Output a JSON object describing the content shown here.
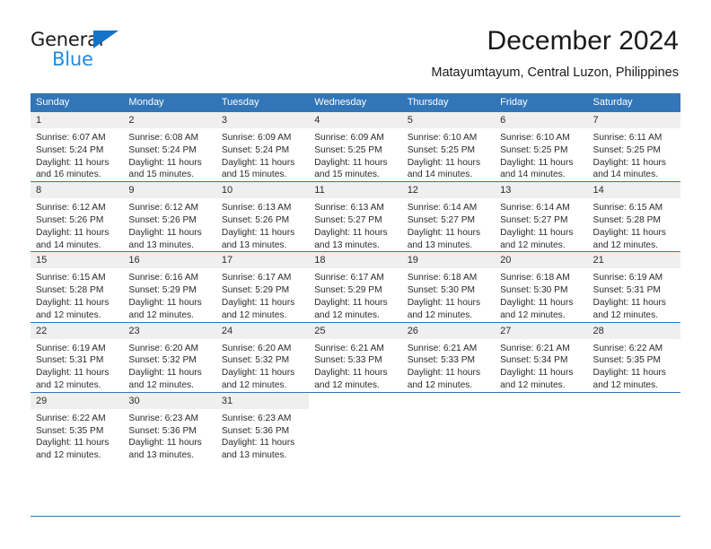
{
  "brand": {
    "name_top": "General",
    "name_bottom": "Blue",
    "triangle_icon": "blue-triangle-logo-mark",
    "accent_color": "#1f8ae0"
  },
  "header": {
    "title": "December 2024",
    "subtitle": "Matayumtayum, Central Luzon, Philippines"
  },
  "theme": {
    "header_blue": "#3276b8",
    "daynum_band": "#efefef",
    "text": "#2b2b2b"
  },
  "weekdays": [
    "Sunday",
    "Monday",
    "Tuesday",
    "Wednesday",
    "Thursday",
    "Friday",
    "Saturday"
  ],
  "weeks": [
    [
      {
        "day": "1",
        "sunrise": "Sunrise: 6:07 AM",
        "sunset": "Sunset: 5:24 PM",
        "daylight1": "Daylight: 11 hours",
        "daylight2": "and 16 minutes."
      },
      {
        "day": "2",
        "sunrise": "Sunrise: 6:08 AM",
        "sunset": "Sunset: 5:24 PM",
        "daylight1": "Daylight: 11 hours",
        "daylight2": "and 15 minutes."
      },
      {
        "day": "3",
        "sunrise": "Sunrise: 6:09 AM",
        "sunset": "Sunset: 5:24 PM",
        "daylight1": "Daylight: 11 hours",
        "daylight2": "and 15 minutes."
      },
      {
        "day": "4",
        "sunrise": "Sunrise: 6:09 AM",
        "sunset": "Sunset: 5:25 PM",
        "daylight1": "Daylight: 11 hours",
        "daylight2": "and 15 minutes."
      },
      {
        "day": "5",
        "sunrise": "Sunrise: 6:10 AM",
        "sunset": "Sunset: 5:25 PM",
        "daylight1": "Daylight: 11 hours",
        "daylight2": "and 14 minutes."
      },
      {
        "day": "6",
        "sunrise": "Sunrise: 6:10 AM",
        "sunset": "Sunset: 5:25 PM",
        "daylight1": "Daylight: 11 hours",
        "daylight2": "and 14 minutes."
      },
      {
        "day": "7",
        "sunrise": "Sunrise: 6:11 AM",
        "sunset": "Sunset: 5:25 PM",
        "daylight1": "Daylight: 11 hours",
        "daylight2": "and 14 minutes."
      }
    ],
    [
      {
        "day": "8",
        "sunrise": "Sunrise: 6:12 AM",
        "sunset": "Sunset: 5:26 PM",
        "daylight1": "Daylight: 11 hours",
        "daylight2": "and 14 minutes."
      },
      {
        "day": "9",
        "sunrise": "Sunrise: 6:12 AM",
        "sunset": "Sunset: 5:26 PM",
        "daylight1": "Daylight: 11 hours",
        "daylight2": "and 13 minutes."
      },
      {
        "day": "10",
        "sunrise": "Sunrise: 6:13 AM",
        "sunset": "Sunset: 5:26 PM",
        "daylight1": "Daylight: 11 hours",
        "daylight2": "and 13 minutes."
      },
      {
        "day": "11",
        "sunrise": "Sunrise: 6:13 AM",
        "sunset": "Sunset: 5:27 PM",
        "daylight1": "Daylight: 11 hours",
        "daylight2": "and 13 minutes."
      },
      {
        "day": "12",
        "sunrise": "Sunrise: 6:14 AM",
        "sunset": "Sunset: 5:27 PM",
        "daylight1": "Daylight: 11 hours",
        "daylight2": "and 13 minutes."
      },
      {
        "day": "13",
        "sunrise": "Sunrise: 6:14 AM",
        "sunset": "Sunset: 5:27 PM",
        "daylight1": "Daylight: 11 hours",
        "daylight2": "and 12 minutes."
      },
      {
        "day": "14",
        "sunrise": "Sunrise: 6:15 AM",
        "sunset": "Sunset: 5:28 PM",
        "daylight1": "Daylight: 11 hours",
        "daylight2": "and 12 minutes."
      }
    ],
    [
      {
        "day": "15",
        "sunrise": "Sunrise: 6:15 AM",
        "sunset": "Sunset: 5:28 PM",
        "daylight1": "Daylight: 11 hours",
        "daylight2": "and 12 minutes."
      },
      {
        "day": "16",
        "sunrise": "Sunrise: 6:16 AM",
        "sunset": "Sunset: 5:29 PM",
        "daylight1": "Daylight: 11 hours",
        "daylight2": "and 12 minutes."
      },
      {
        "day": "17",
        "sunrise": "Sunrise: 6:17 AM",
        "sunset": "Sunset: 5:29 PM",
        "daylight1": "Daylight: 11 hours",
        "daylight2": "and 12 minutes."
      },
      {
        "day": "18",
        "sunrise": "Sunrise: 6:17 AM",
        "sunset": "Sunset: 5:29 PM",
        "daylight1": "Daylight: 11 hours",
        "daylight2": "and 12 minutes."
      },
      {
        "day": "19",
        "sunrise": "Sunrise: 6:18 AM",
        "sunset": "Sunset: 5:30 PM",
        "daylight1": "Daylight: 11 hours",
        "daylight2": "and 12 minutes."
      },
      {
        "day": "20",
        "sunrise": "Sunrise: 6:18 AM",
        "sunset": "Sunset: 5:30 PM",
        "daylight1": "Daylight: 11 hours",
        "daylight2": "and 12 minutes."
      },
      {
        "day": "21",
        "sunrise": "Sunrise: 6:19 AM",
        "sunset": "Sunset: 5:31 PM",
        "daylight1": "Daylight: 11 hours",
        "daylight2": "and 12 minutes."
      }
    ],
    [
      {
        "day": "22",
        "sunrise": "Sunrise: 6:19 AM",
        "sunset": "Sunset: 5:31 PM",
        "daylight1": "Daylight: 11 hours",
        "daylight2": "and 12 minutes."
      },
      {
        "day": "23",
        "sunrise": "Sunrise: 6:20 AM",
        "sunset": "Sunset: 5:32 PM",
        "daylight1": "Daylight: 11 hours",
        "daylight2": "and 12 minutes."
      },
      {
        "day": "24",
        "sunrise": "Sunrise: 6:20 AM",
        "sunset": "Sunset: 5:32 PM",
        "daylight1": "Daylight: 11 hours",
        "daylight2": "and 12 minutes."
      },
      {
        "day": "25",
        "sunrise": "Sunrise: 6:21 AM",
        "sunset": "Sunset: 5:33 PM",
        "daylight1": "Daylight: 11 hours",
        "daylight2": "and 12 minutes."
      },
      {
        "day": "26",
        "sunrise": "Sunrise: 6:21 AM",
        "sunset": "Sunset: 5:33 PM",
        "daylight1": "Daylight: 11 hours",
        "daylight2": "and 12 minutes."
      },
      {
        "day": "27",
        "sunrise": "Sunrise: 6:21 AM",
        "sunset": "Sunset: 5:34 PM",
        "daylight1": "Daylight: 11 hours",
        "daylight2": "and 12 minutes."
      },
      {
        "day": "28",
        "sunrise": "Sunrise: 6:22 AM",
        "sunset": "Sunset: 5:35 PM",
        "daylight1": "Daylight: 11 hours",
        "daylight2": "and 12 minutes."
      }
    ],
    [
      {
        "day": "29",
        "sunrise": "Sunrise: 6:22 AM",
        "sunset": "Sunset: 5:35 PM",
        "daylight1": "Daylight: 11 hours",
        "daylight2": "and 12 minutes."
      },
      {
        "day": "30",
        "sunrise": "Sunrise: 6:23 AM",
        "sunset": "Sunset: 5:36 PM",
        "daylight1": "Daylight: 11 hours",
        "daylight2": "and 13 minutes."
      },
      {
        "day": "31",
        "sunrise": "Sunrise: 6:23 AM",
        "sunset": "Sunset: 5:36 PM",
        "daylight1": "Daylight: 11 hours",
        "daylight2": "and 13 minutes."
      },
      {
        "day": "",
        "sunrise": "",
        "sunset": "",
        "daylight1": "",
        "daylight2": ""
      },
      {
        "day": "",
        "sunrise": "",
        "sunset": "",
        "daylight1": "",
        "daylight2": ""
      },
      {
        "day": "",
        "sunrise": "",
        "sunset": "",
        "daylight1": "",
        "daylight2": ""
      },
      {
        "day": "",
        "sunrise": "",
        "sunset": "",
        "daylight1": "",
        "daylight2": ""
      }
    ]
  ]
}
